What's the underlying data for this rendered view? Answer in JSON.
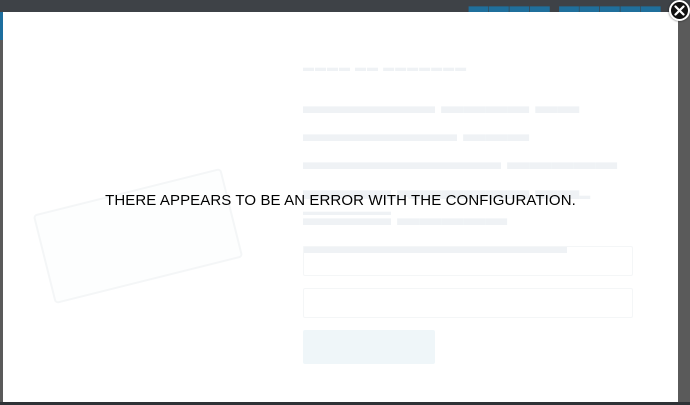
{
  "modal": {
    "error_message": "THERE APPEARS TO BE AN ERROR WITH THE CONFIGURATION."
  },
  "icons": {
    "close": "close-icon"
  },
  "colors": {
    "modal_background": "#ffffff",
    "error_text": "#000000",
    "close_button": "#111111",
    "page_accent": "#1f6f9c"
  }
}
